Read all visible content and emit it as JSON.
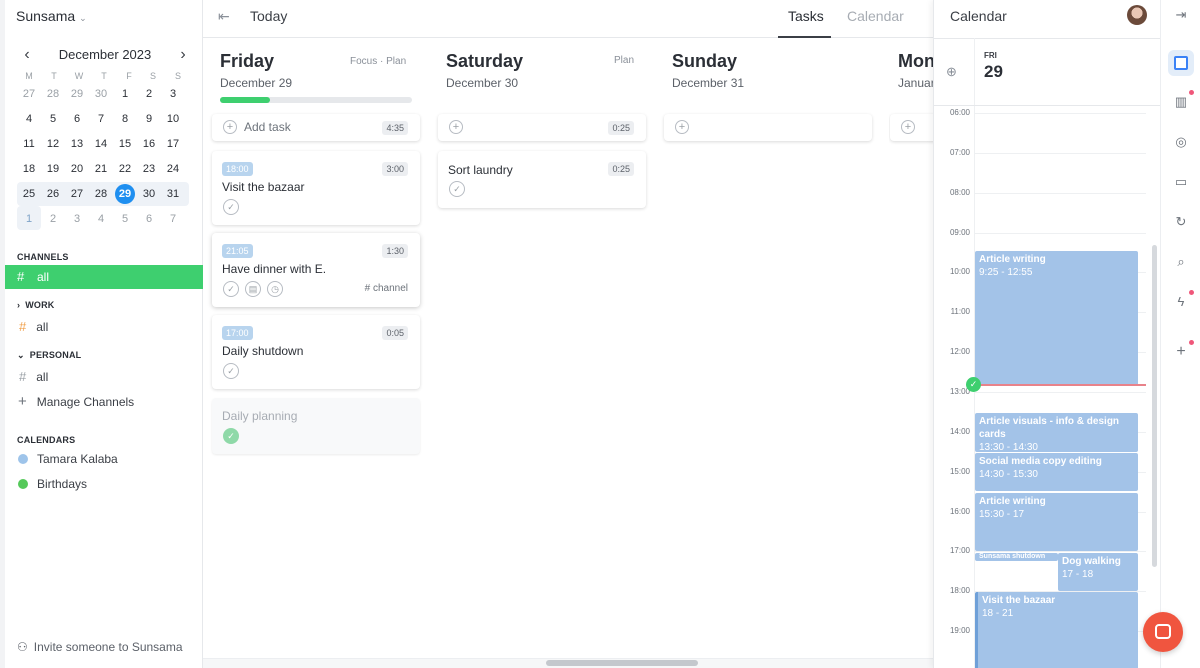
{
  "workspace": "Sunsama",
  "mini_calendar": {
    "month": "December 2023",
    "weekdays": [
      "M",
      "T",
      "W",
      "T",
      "F",
      "S",
      "S"
    ],
    "weeks": [
      [
        "27",
        "28",
        "29",
        "30",
        "1",
        "2",
        "3"
      ],
      [
        "4",
        "5",
        "6",
        "7",
        "8",
        "9",
        "10"
      ],
      [
        "11",
        "12",
        "13",
        "14",
        "15",
        "16",
        "17"
      ],
      [
        "18",
        "19",
        "20",
        "21",
        "22",
        "23",
        "24"
      ],
      [
        "25",
        "26",
        "27",
        "28",
        "29",
        "30",
        "31"
      ],
      [
        "1",
        "2",
        "3",
        "4",
        "5",
        "6",
        "7"
      ]
    ]
  },
  "channels": {
    "heading": "CHANNELS",
    "all": "all",
    "work_heading": "WORK",
    "work_all": "all",
    "personal_heading": "PERSONAL",
    "personal_all": "all",
    "manage": "Manage Channels"
  },
  "calendars": {
    "heading": "CALENDARS",
    "items": [
      {
        "name": "Tamara Kalaba",
        "color": "#9ec4ea"
      },
      {
        "name": "Birthdays",
        "color": "#55c95a"
      }
    ]
  },
  "invite": "Invite someone to Sunsama",
  "topbar": {
    "title": "Today",
    "tab_tasks": "Tasks",
    "tab_calendar": "Calendar"
  },
  "columns": [
    {
      "day": "Friday",
      "date": "December 29",
      "focus": "Focus",
      "sep": "·",
      "plan": "Plan",
      "progress": 0.26,
      "add_label": "Add task",
      "add_total": "4:35"
    },
    {
      "day": "Saturday",
      "date": "December 30",
      "plan": "Plan",
      "add_total": "0:25"
    },
    {
      "day": "Sunday",
      "date": "December 31"
    },
    {
      "day": "Mon",
      "date": "Januar"
    }
  ],
  "tasks_friday": [
    {
      "time": "18:00",
      "duration": "3:00",
      "title": "Visit the bazaar"
    },
    {
      "time": "21:05",
      "duration": "1:30",
      "title": "Have dinner with E.",
      "channel": "channel"
    },
    {
      "time": "17:00",
      "duration": "0:05",
      "title": "Daily shutdown"
    },
    {
      "title": "Daily planning",
      "completed": true
    }
  ],
  "tasks_saturday": [
    {
      "duration": "0:25",
      "title": "Sort laundry"
    }
  ],
  "calendar_panel": {
    "title": "Calendar",
    "dow": "FRI",
    "day": "29",
    "hours": [
      "06:00",
      "07:00",
      "08:00",
      "09:00",
      "10:00",
      "11:00",
      "12:00",
      "13:00",
      "14:00",
      "15:00",
      "16:00",
      "17:00",
      "18:00",
      "19:00"
    ],
    "events": [
      {
        "name": "Article writing",
        "time": "9:25 - 12:55"
      },
      {
        "name": "Article visuals - info & design cards",
        "time": "13:30 - 14:30"
      },
      {
        "name": "Social media copy editing",
        "time": "14:30 - 15:30"
      },
      {
        "name": "Article writing",
        "time": "15:30 - 17"
      },
      {
        "name": "Sunsama shutdown",
        "time": ""
      },
      {
        "name": "Dog walking",
        "time": "17 - 18"
      },
      {
        "name": "Visit the bazaar",
        "time": "18 - 21"
      }
    ]
  },
  "colors": {
    "accent_green": "#3ecf6f",
    "today_blue": "#1f8ff0",
    "event_blue": "#a3c3e8",
    "now_line": "#e8828a",
    "chat_button": "#f0553f"
  }
}
